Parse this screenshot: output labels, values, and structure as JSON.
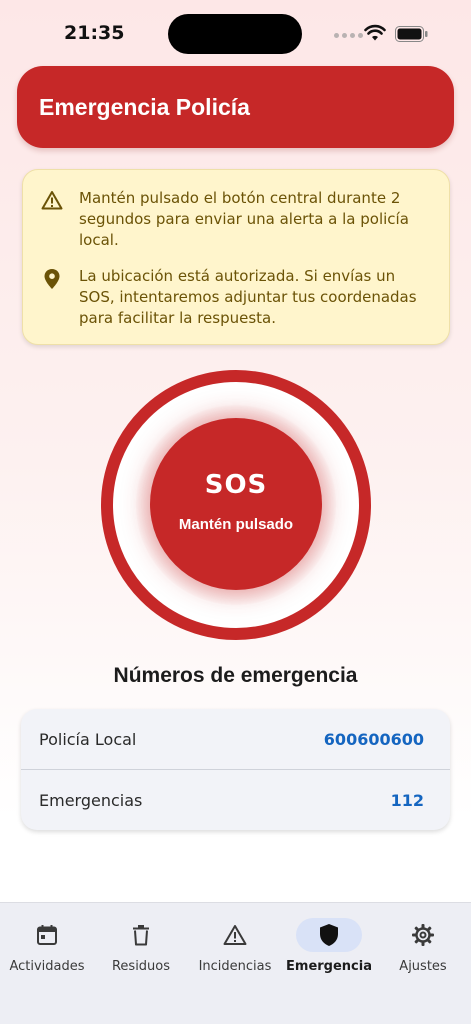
{
  "status_bar": {
    "time": "21:35"
  },
  "header": {
    "title": "Emergencia Policía"
  },
  "info": {
    "alert_text": "Mantén pulsado el botón central durante 2 segundos para enviar una alerta a la policía local.",
    "location_text": "La ubicación está autorizada. Si envías un SOS, intentaremos adjuntar tus coordenadas para facilitar la respuesta."
  },
  "sos": {
    "label": "SOS",
    "sublabel": "Mantén pulsado"
  },
  "numbers": {
    "title": "Números de emergencia",
    "items": [
      {
        "label": "Policía Local",
        "value": "600600600"
      },
      {
        "label": "Emergencias",
        "value": "112"
      }
    ]
  },
  "nav": {
    "items": [
      {
        "label": "Actividades",
        "icon": "calendar-icon"
      },
      {
        "label": "Residuos",
        "icon": "trash-icon"
      },
      {
        "label": "Incidencias",
        "icon": "warning-icon"
      },
      {
        "label": "Emergencia",
        "icon": "shield-icon"
      },
      {
        "label": "Ajustes",
        "icon": "gear-icon"
      }
    ],
    "active_index": 3
  },
  "colors": {
    "primary_red": "#c62828",
    "info_background": "#fff5cc",
    "info_text": "#6b5307",
    "link_blue": "#1565c0"
  }
}
